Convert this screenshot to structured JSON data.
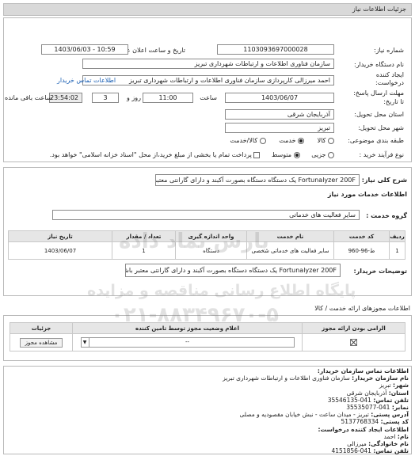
{
  "header": {
    "title": "جزئیات اطلاعات نیاز"
  },
  "need_number": {
    "label": "شماره نیاز:",
    "value": "1103093697000028"
  },
  "announce_date": {
    "label": "تاریخ و ساعت اعلان عمومی:",
    "value": "1403/06/03 - 10:59"
  },
  "buyer_org": {
    "label": "نام دستگاه خریدار:",
    "value": "سازمان فناوری اطلاعات و ارتباطات شهرداری تبریز"
  },
  "creator": {
    "label1": "ایجاد کننده",
    "label2": "درخواست:",
    "value": "احمد میرزالی کارپردازی سازمان فناوری اطلاعات و ارتباطات شهرداری تبریز",
    "contact_link": "اطلاعات تماس خریدار"
  },
  "deadline": {
    "label1": "مهلت ارسال پاسخ:",
    "label2": "تا تاریخ:",
    "date": "1403/06/07",
    "time_label": "ساعت",
    "time": "11:00",
    "days": "3",
    "days_label": "روز و",
    "remaining": "23:54:02",
    "remaining_label": "ساعت باقی مانده"
  },
  "province": {
    "label": "استان محل تحویل:",
    "value": "آذربایجان شرقی"
  },
  "city": {
    "label": "شهر محل تحویل:",
    "value": "تبریز"
  },
  "category": {
    "label": "طبقه بندی موضوعی:",
    "options": [
      "کالا",
      "خدمت",
      "کالا/خدمت"
    ],
    "selected": "خدمت"
  },
  "purchase": {
    "label": "نوع فرآیند خرید :",
    "options": [
      "جزیی",
      "متوسط"
    ],
    "selected": "متوسط",
    "note": "پرداخت تمام یا بخشی از مبلغ خرید،از محل \"اسناد خزانه اسلامی\" خواهد بود."
  },
  "summary": {
    "label": "شرح کلی نیاز:",
    "value": "Fortunalyzer 200F یک دستگاه دستگاه بصورت آکبند و دارای گارانتی معتبر باشد."
  },
  "services_info": {
    "title": "اطلاعات خدمات مورد نیاز"
  },
  "service_group": {
    "label": "گروه خدمت :",
    "value": "سایر فعالیت های خدماتی"
  },
  "services_table": {
    "headers": [
      "ردیف",
      "کد خدمت",
      "نام خدمت",
      "واحد اندازه گیری",
      "تعداد / مقدار",
      "تاریخ نیاز"
    ],
    "rows": [
      [
        "1",
        "ط-96-960",
        "سایر فعالیت های خدماتی شخصی",
        "دستگاه",
        "1",
        "1403/06/07"
      ]
    ]
  },
  "buyer_notes": {
    "label": "توضیحات خریدار:",
    "value": "Fortunalyzer 200F یک دستگاه دستگاه بصورت آکبند و دارای گارانتی معتبر باشد."
  },
  "docs": {
    "title": "اطلاعات مجوزهای ارائه خدمت / کالا"
  },
  "docs_table": {
    "headers": [
      "الزامی بودن ارائه مجوز",
      "اعلام وضعیت مجوز توسط تامین کننده",
      "جزئیات"
    ],
    "select_value": "--",
    "view_button": "مشاهده مجوز"
  },
  "contact": {
    "title": "اطلاعات تماس سازمان خریدار:",
    "lines": [
      {
        "label": "نام سازمان خریدار:",
        "value": "سازمان فناوری اطلاعات و ارتباطات شهرداری تبریز"
      },
      {
        "label": "شهر:",
        "value": "تبریز"
      },
      {
        "label": "استان:",
        "value": "آذربایجان شرقی"
      },
      {
        "label": "تلفن تماس:",
        "value": "041-35546135"
      },
      {
        "label": "نمابر:",
        "value": "041-35535077"
      },
      {
        "label": "آدرس پستی:",
        "value": "تبریز - میدان ساعت - نبش خیابان مقصودیه و مصلی"
      },
      {
        "label": "کد پستی:",
        "value": "5137768334"
      },
      {
        "label": "اطلاعات ایجاد کننده درخواست:",
        "value": ""
      },
      {
        "label": "نام:",
        "value": "احمد"
      },
      {
        "label": "نام خانوادگی:",
        "value": "میرزالی"
      },
      {
        "label": "تلفن تماس:",
        "value": "041-4151856"
      }
    ]
  },
  "watermark": {
    "brand": "پارس نماد داده",
    "site": "پایگاه اطلاع رسانی مناقصه و مزایده",
    "phone": "۰۲۱-۸۸۳۴۹۶۷۰-۵"
  },
  "colors": {
    "header_bg": "#d9d9d9",
    "link": "#1a5fb4"
  }
}
